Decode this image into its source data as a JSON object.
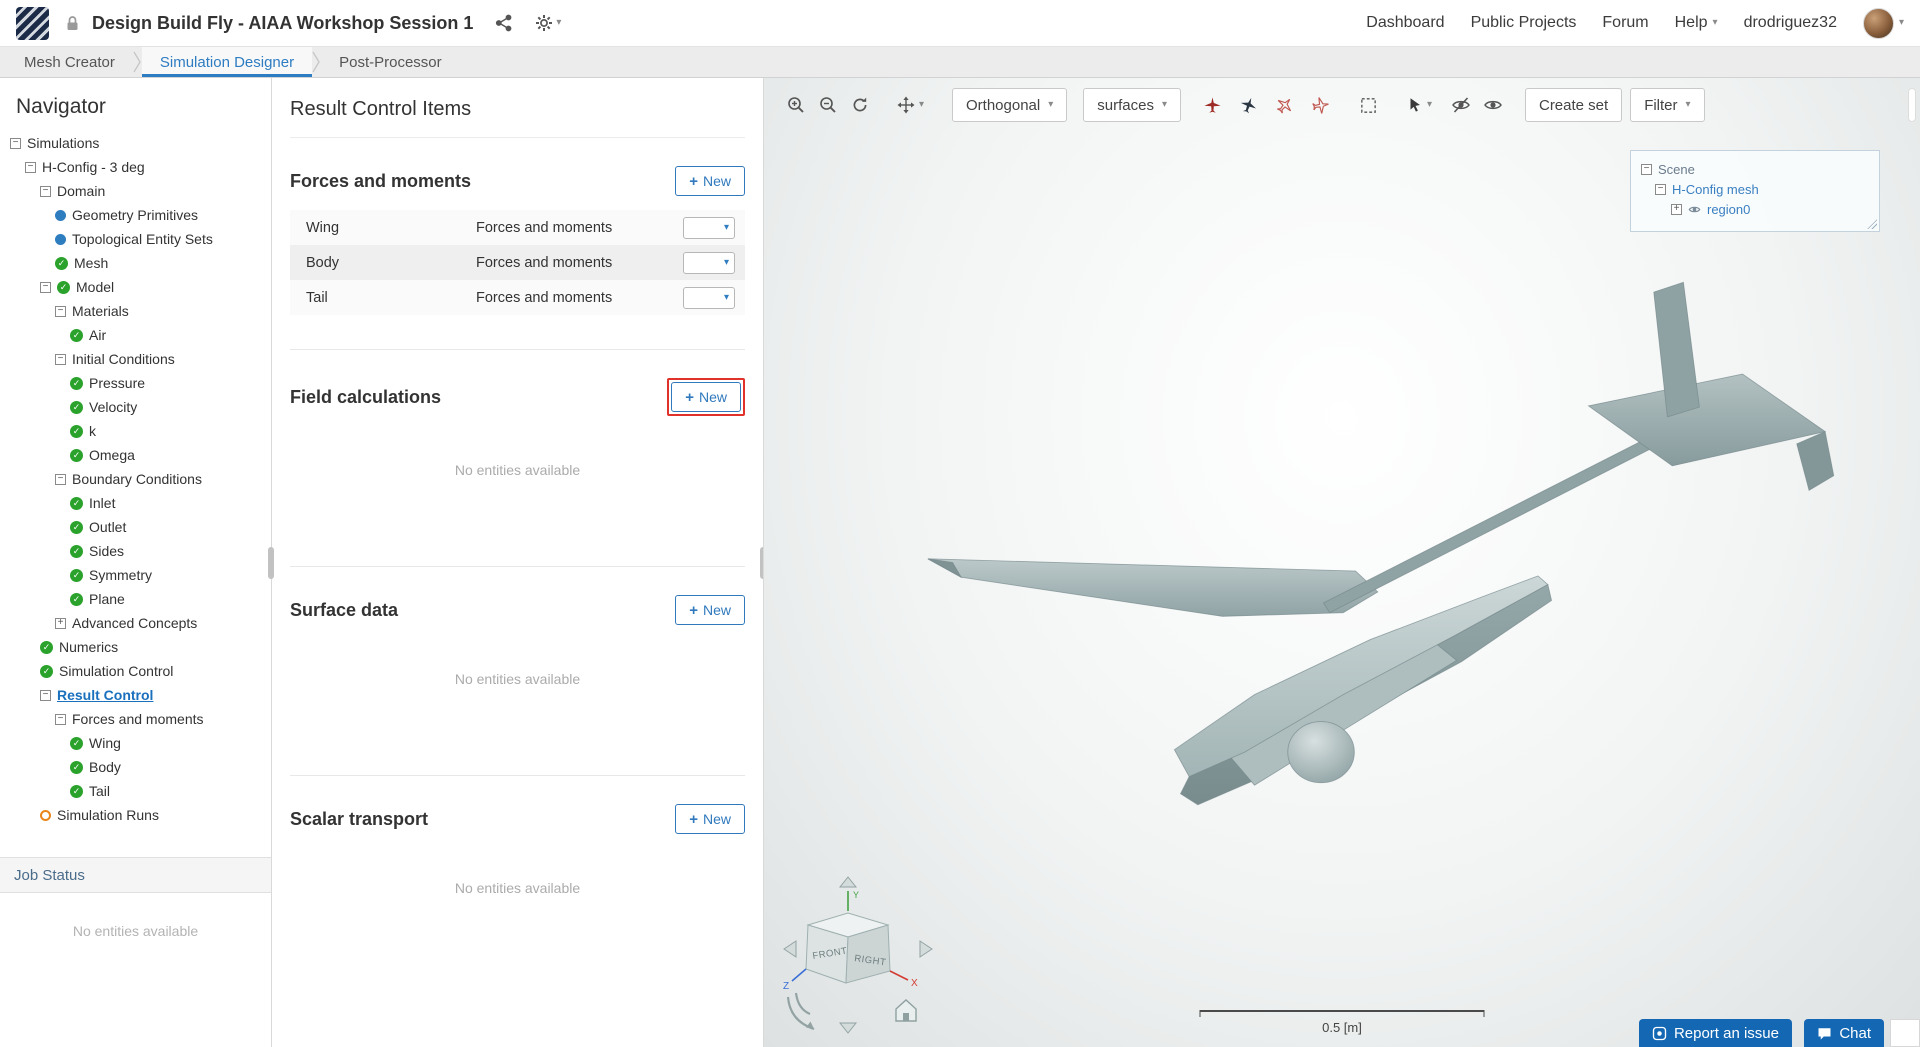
{
  "header": {
    "title": "Design Build Fly - AIAA Workshop Session 1",
    "nav": {
      "dashboard": "Dashboard",
      "public_projects": "Public Projects",
      "forum": "Forum",
      "help": "Help",
      "username": "drodriguez32"
    }
  },
  "tabs": {
    "mesh": "Mesh Creator",
    "sim": "Simulation Designer",
    "post": "Post-Processor"
  },
  "navigator": {
    "title": "Navigator",
    "tree": [
      {
        "label": "Simulations",
        "depth": 0,
        "icons": [
          "minus"
        ]
      },
      {
        "label": "H-Config - 3 deg",
        "depth": 1,
        "icons": [
          "minus"
        ]
      },
      {
        "label": "Domain",
        "depth": 2,
        "icons": [
          "minus"
        ]
      },
      {
        "label": "Geometry Primitives",
        "depth": 3,
        "icons": [
          "dot"
        ]
      },
      {
        "label": "Topological Entity Sets",
        "depth": 3,
        "icons": [
          "dot"
        ]
      },
      {
        "label": "Mesh",
        "depth": 3,
        "icons": [
          "check"
        ]
      },
      {
        "label": "Model",
        "depth": 2,
        "icons": [
          "minus",
          "check"
        ]
      },
      {
        "label": "Materials",
        "depth": 3,
        "icons": [
          "minus"
        ]
      },
      {
        "label": "Air",
        "depth": 4,
        "icons": [
          "check"
        ]
      },
      {
        "label": "Initial Conditions",
        "depth": 3,
        "icons": [
          "minus"
        ]
      },
      {
        "label": "Pressure",
        "depth": 4,
        "icons": [
          "check"
        ]
      },
      {
        "label": "Velocity",
        "depth": 4,
        "icons": [
          "check"
        ]
      },
      {
        "label": "k",
        "depth": 4,
        "icons": [
          "check"
        ]
      },
      {
        "label": "Omega",
        "depth": 4,
        "icons": [
          "check"
        ]
      },
      {
        "label": "Boundary Conditions",
        "depth": 3,
        "icons": [
          "minus"
        ]
      },
      {
        "label": "Inlet",
        "depth": 4,
        "icons": [
          "check"
        ]
      },
      {
        "label": "Outlet",
        "depth": 4,
        "icons": [
          "check"
        ]
      },
      {
        "label": "Sides",
        "depth": 4,
        "icons": [
          "check"
        ]
      },
      {
        "label": "Symmetry",
        "depth": 4,
        "icons": [
          "check"
        ]
      },
      {
        "label": "Plane",
        "depth": 4,
        "icons": [
          "check"
        ]
      },
      {
        "label": "Advanced Concepts",
        "depth": 3,
        "icons": [
          "plus"
        ]
      },
      {
        "label": "Numerics",
        "depth": 2,
        "icons": [
          "check"
        ]
      },
      {
        "label": "Simulation Control",
        "depth": 2,
        "icons": [
          "check"
        ]
      },
      {
        "label": "Result Control",
        "depth": 2,
        "icons": [
          "minus"
        ],
        "selected": true
      },
      {
        "label": "Forces and moments",
        "depth": 3,
        "icons": [
          "minus"
        ]
      },
      {
        "label": "Wing",
        "depth": 4,
        "icons": [
          "check"
        ]
      },
      {
        "label": "Body",
        "depth": 4,
        "icons": [
          "check"
        ]
      },
      {
        "label": "Tail",
        "depth": 4,
        "icons": [
          "check"
        ]
      },
      {
        "label": "Simulation Runs",
        "depth": 2,
        "icons": [
          "pending"
        ]
      }
    ],
    "job_status": {
      "title": "Job Status",
      "empty": "No entities available"
    }
  },
  "result_panel": {
    "title": "Result Control Items",
    "new_label": "New",
    "empty_text": "No entities available",
    "sections": [
      {
        "title": "Forces and moments",
        "items": [
          {
            "name": "Wing",
            "type": "Forces and moments"
          },
          {
            "name": "Body",
            "type": "Forces and moments"
          },
          {
            "name": "Tail",
            "type": "Forces and moments"
          }
        ]
      },
      {
        "title": "Field calculations",
        "highlight_new": true,
        "empty": true
      },
      {
        "title": "Surface data",
        "empty": true
      },
      {
        "title": "Scalar transport",
        "empty": true
      }
    ]
  },
  "viewport": {
    "toolbar": {
      "orthogonal": "Orthogonal",
      "surfaces": "surfaces",
      "create_set": "Create set",
      "filter": "Filter"
    },
    "scene_tree": {
      "scene": "Scene",
      "mesh": "H-Config mesh",
      "region": "region0"
    },
    "cube": {
      "front": "FRONT",
      "right": "RIGHT",
      "x": "X",
      "y": "Y",
      "z": "Z"
    },
    "scale_label": "0.5 [m]",
    "report_issue": "Report an issue",
    "chat": "Chat"
  },
  "colors": {
    "accent_blue": "#2e7cc1",
    "check_green": "#2ba22b",
    "pending_orange": "#e8861a",
    "highlight_red": "#e0312b",
    "button_blue": "#1467b3",
    "model_gray": "#a3b5b6"
  }
}
